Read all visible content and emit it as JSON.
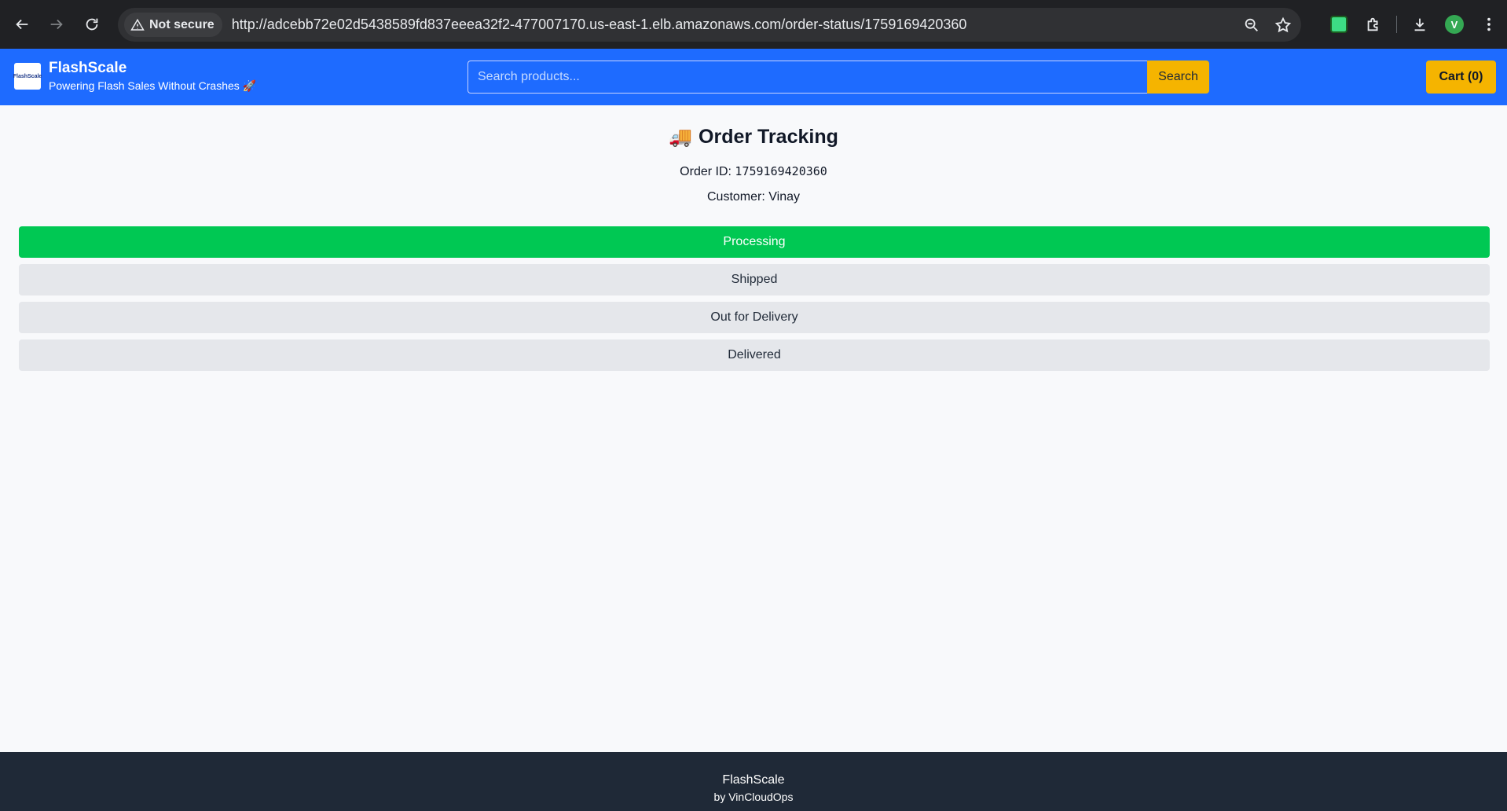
{
  "browser": {
    "security_label": "Not secure",
    "url": "http://adcebb72e02d5438589fd837eeea32f2-477007170.us-east-1.elb.amazonaws.com/order-status/1759169420360",
    "profile_initial": "V"
  },
  "header": {
    "brand_name": "FlashScale",
    "logo_text": "FlashScale",
    "tagline": "Powering Flash Sales Without Crashes 🚀",
    "search_placeholder": "Search products...",
    "search_button": "Search",
    "cart_button": "Cart (0)"
  },
  "order": {
    "title_icon": "🚚",
    "title": "Order Tracking",
    "order_id_label": "Order ID:",
    "order_id": "1759169420360",
    "customer_label": "Customer:",
    "customer_name": "Vinay",
    "steps": [
      {
        "label": "Processing",
        "active": true
      },
      {
        "label": "Shipped",
        "active": false
      },
      {
        "label": "Out for Delivery",
        "active": false
      },
      {
        "label": "Delivered",
        "active": false
      }
    ]
  },
  "footer": {
    "title": "FlashScale",
    "subtitle": "by VinCloudOps"
  },
  "colors": {
    "header_bg": "#1e6bff",
    "accent_yellow": "#f5b400",
    "active_step": "#00c853",
    "inactive_step": "#e5e7eb",
    "footer_bg": "#1f2937"
  }
}
